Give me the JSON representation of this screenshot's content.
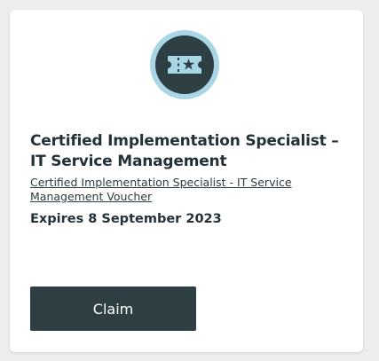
{
  "card": {
    "badge_icon": "ticket-star-icon",
    "title": "Certified Implementation Specialist – IT Service Management",
    "voucher_link": "Certified Implementation Specialist - IT Service Management Voucher",
    "expires": "Expires 8 September 2023",
    "claim_label": "Claim"
  },
  "colors": {
    "badge_ring": "#a9d6e5",
    "badge_fill": "#2e3f44",
    "button_bg": "#2e3f44",
    "text": "#233238"
  }
}
